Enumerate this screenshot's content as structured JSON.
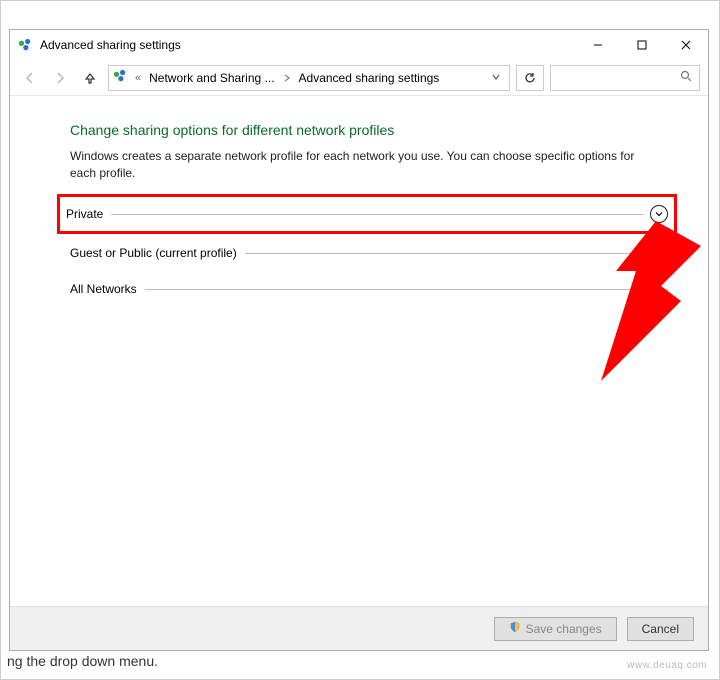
{
  "titlebar": {
    "title": "Advanced sharing settings"
  },
  "breadcrumb": {
    "crumb1": "Network and Sharing ...",
    "crumb2": "Advanced sharing settings"
  },
  "content": {
    "heading": "Change sharing options for different network profiles",
    "desc": "Windows creates a separate network profile for each network you use. You can choose specific options for each profile.",
    "sections": [
      {
        "label": "Private"
      },
      {
        "label": "Guest or Public (current profile)"
      },
      {
        "label": "All Networks"
      }
    ]
  },
  "footer": {
    "save": "Save changes",
    "cancel": "Cancel"
  },
  "watermark": "www.deuaq.com"
}
